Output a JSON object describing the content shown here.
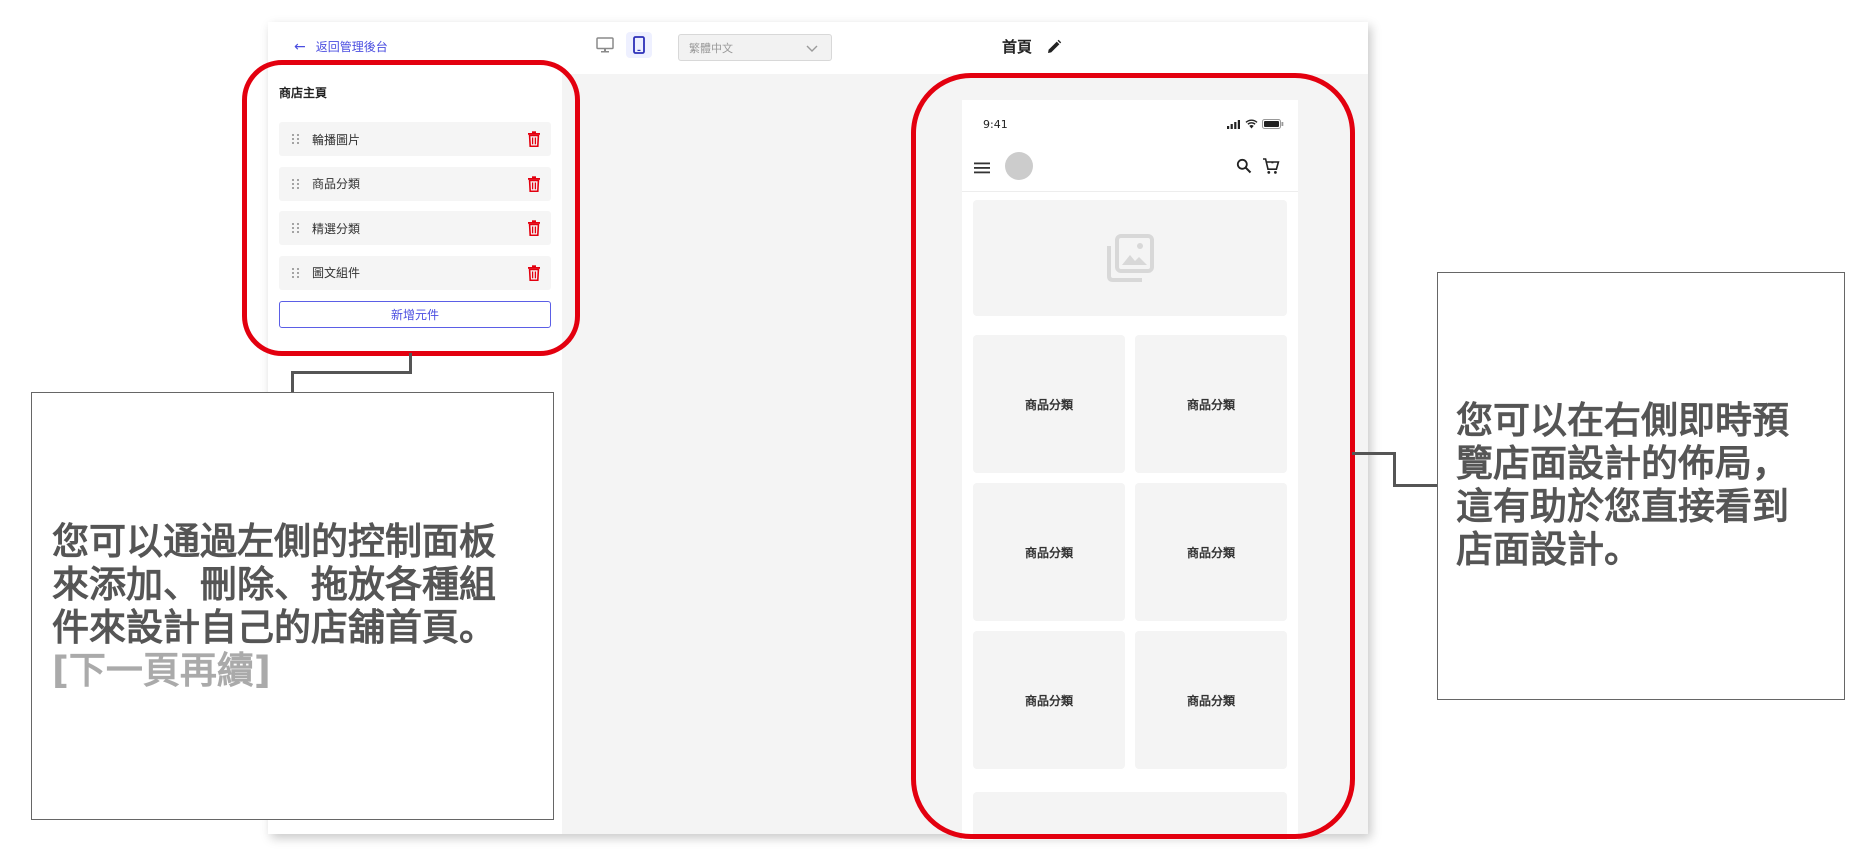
{
  "sidebar": {
    "back_label": "返回管理後台",
    "section_title": "商店主頁",
    "items": [
      {
        "label": "輪播圖片"
      },
      {
        "label": "商品分類"
      },
      {
        "label": "精選分類"
      },
      {
        "label": "圖文組件"
      }
    ],
    "add_label": "新增元件"
  },
  "topbar": {
    "language": "繁體中文",
    "page_title": "首頁"
  },
  "preview": {
    "time": "9:41",
    "category_cards": [
      "商品分類",
      "商品分類",
      "商品分類",
      "商品分類",
      "商品分類",
      "商品分類"
    ]
  },
  "colors": {
    "accent": "#4a4de0",
    "delete": "#e3000f",
    "highlight": "#e3000f"
  },
  "callouts": {
    "left": {
      "lines": [
        "您可以通過左側的控制面板",
        "來添加、刪除、拖放各種組",
        "件來設計自己的店舖首頁。"
      ],
      "more": "[下一頁再續]"
    },
    "right": {
      "lines": [
        "您可以在右側即時預",
        "覽店面設計的佈局，",
        "這有助於您直接看到",
        "店面設計。"
      ]
    }
  }
}
